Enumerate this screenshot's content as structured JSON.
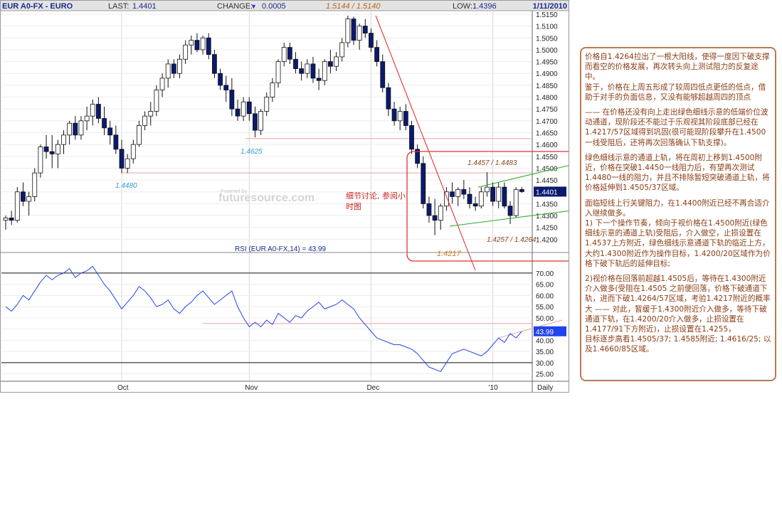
{
  "header": {
    "symbol": "EUR A0-FX - EURO",
    "last_label": "LAST:",
    "last_value": "1.4401",
    "high_low_text": "1.5144 / 1.5140",
    "change_label": "CHANGE:",
    "change_arrow": "▼",
    "change_value": "0.0005",
    "low_label": "LOW:",
    "low_value": "1.4396",
    "date": "1/11/2010"
  },
  "watermark": "futuresource.com",
  "watermark_small": "Powered by",
  "annotations": {
    "level_1_5144": "1.5144 / 1.5140",
    "level_1_4625": "1.4625",
    "level_1_4480": "1.4480",
    "level_1_4457": "1.4457 / 1.4483",
    "level_1_4257": "1.4257 / 1.4264",
    "level_1_4217": "1.4217",
    "note": "细节讨论, 参阅小\n时图"
  },
  "rsi": {
    "title": "RSI (EUR A0-FX,14) = 43.99",
    "value_label": "43.99"
  },
  "commentary": {
    "p1": "价格自1.4264拉出了一根大阳线，使得一度因下破支撑而看空的价格发展，再次转头向上测试阻力的反复途中。\n鉴于，价格在上周五形成了较周四低点更低的低点，借助于对手的负面信息，又没有能够超越周四的顶点",
    "p2": "—— 在价格还没有向上走出绿色细线示意的低端价位波动通道，现阶段还不能过于乐观视其阶段底部已经在1.4217/57区域得到巩固(很可能现阶段攀升在1.4500一线受阻后，还将再次回落确认下轨支撑)。",
    "p3": "绿色细线示意的通道上轨，将在周初上移到1.4500附近，价格在突破1.4450一线阻力后，有望再次测试1.4480一线的阻力，并且不排除暂短突破通道上轨，将价格延伸到1.4505/37区域。",
    "p4": "面临短线上行关键阻力，在1.4400附近已经不再合适介入继续做多。\n1) 下一个操作节奏，倾向于视价格在1.4500附近(绿色细线示意的通道上轨)受阻后，介入做空，止损设置在1.4537上方附近，绿色细线示意通道下轨的临近上方，大约1.4300附近作为操作目标，1.4200/20区域作为价格下破下轨后的延伸目标;",
    "p5": "2)视价格在回落前超越1.4505后，等待在1.4300附近介入做多(受阻在1.4505 之前便回落，价格下破通道下轨，进而下破1.4264/57区域，考验1.4217附近的概率大 —— 对此，暂缓于1.4300附近介入做多，等待下破通道下轨，在1.4200/20介入做多，止损设置在1.4177/91下方附近)，止损设置在1.4255，\n目标逐步高看1.4505/37; 1.4585附近; 1.4616/25; 以及1.4660/85区域。"
  },
  "colors": {
    "up_candle": "#ffffff",
    "down_candle": "#0a1a6e",
    "trend_red": "#dd2222",
    "channel_green": "#22aa22",
    "rsi_line": "#2244ee",
    "accent_box": "#dd3333",
    "commentary_text": "#8a3c14"
  },
  "chart_data": {
    "type": "candlestick",
    "price_axis": {
      "ylim": [
        1.4165,
        1.5165
      ],
      "ticks": [
        "1.5150",
        "1.5100",
        "1.5050",
        "1.5000",
        "1.4950",
        "1.4900",
        "1.4850",
        "1.4800",
        "1.4750",
        "1.4700",
        "1.4650",
        "1.4600",
        "1.4550",
        "1.4500",
        "1.4450",
        "1.4400",
        "1.4350",
        "1.4300",
        "1.4250",
        "1.4200"
      ]
    },
    "time_axis": {
      "labels": [
        "Oct",
        "Nov",
        "Dec",
        "'10",
        "Daily"
      ]
    },
    "rsi_axis": {
      "ylim": [
        22,
        76
      ],
      "ticks": [
        "70.00",
        "65.00",
        "60.00",
        "55.00",
        "50.00",
        "45.00",
        "40.00",
        "35.00",
        "30.00",
        "25.00"
      ],
      "overbought": 70,
      "oversold": 30
    },
    "ohlc": [
      [
        1.428,
        1.43,
        1.424,
        1.429
      ],
      [
        1.429,
        1.432,
        1.426,
        1.428
      ],
      [
        1.428,
        1.442,
        1.427,
        1.44
      ],
      [
        1.44,
        1.444,
        1.434,
        1.436
      ],
      [
        1.436,
        1.44,
        1.43,
        1.438
      ],
      [
        1.438,
        1.45,
        1.436,
        1.448
      ],
      [
        1.448,
        1.46,
        1.446,
        1.459
      ],
      [
        1.459,
        1.464,
        1.454,
        1.457
      ],
      [
        1.457,
        1.464,
        1.45,
        1.456
      ],
      [
        1.456,
        1.462,
        1.45,
        1.46
      ],
      [
        1.46,
        1.466,
        1.456,
        1.464
      ],
      [
        1.464,
        1.47,
        1.46,
        1.469
      ],
      [
        1.469,
        1.472,
        1.462,
        1.464
      ],
      [
        1.464,
        1.472,
        1.462,
        1.47
      ],
      [
        1.47,
        1.476,
        1.466,
        1.472
      ],
      [
        1.472,
        1.479,
        1.468,
        1.477
      ],
      [
        1.477,
        1.48,
        1.469,
        1.471
      ],
      [
        1.471,
        1.476,
        1.464,
        1.467
      ],
      [
        1.467,
        1.47,
        1.46,
        1.464
      ],
      [
        1.464,
        1.468,
        1.456,
        1.458
      ],
      [
        1.458,
        1.462,
        1.448,
        1.45
      ],
      [
        1.45,
        1.456,
        1.448,
        1.454
      ],
      [
        1.454,
        1.462,
        1.452,
        1.46
      ],
      [
        1.46,
        1.47,
        1.459,
        1.468
      ],
      [
        1.468,
        1.474,
        1.466,
        1.472
      ],
      [
        1.472,
        1.478,
        1.468,
        1.474
      ],
      [
        1.474,
        1.485,
        1.472,
        1.483
      ],
      [
        1.483,
        1.49,
        1.48,
        1.488
      ],
      [
        1.488,
        1.496,
        1.484,
        1.494
      ],
      [
        1.494,
        1.496,
        1.488,
        1.49
      ],
      [
        1.49,
        1.498,
        1.488,
        1.496
      ],
      [
        1.496,
        1.504,
        1.494,
        1.502
      ],
      [
        1.502,
        1.506,
        1.498,
        1.504
      ],
      [
        1.504,
        1.507,
        1.499,
        1.5
      ],
      [
        1.5,
        1.506,
        1.498,
        1.505
      ],
      [
        1.505,
        1.507,
        1.496,
        1.498
      ],
      [
        1.498,
        1.5,
        1.488,
        1.49
      ],
      [
        1.49,
        1.492,
        1.483,
        1.485
      ],
      [
        1.485,
        1.489,
        1.478,
        1.483
      ],
      [
        1.483,
        1.488,
        1.472,
        1.475
      ],
      [
        1.475,
        1.479,
        1.47,
        1.472
      ],
      [
        1.472,
        1.48,
        1.47,
        1.478
      ],
      [
        1.478,
        1.48,
        1.47,
        1.473
      ],
      [
        1.473,
        1.476,
        1.463,
        1.466
      ],
      [
        1.466,
        1.475,
        1.464,
        1.474
      ],
      [
        1.474,
        1.482,
        1.472,
        1.48
      ],
      [
        1.48,
        1.488,
        1.478,
        1.486
      ],
      [
        1.486,
        1.496,
        1.484,
        1.495
      ],
      [
        1.495,
        1.503,
        1.493,
        1.501
      ],
      [
        1.501,
        1.503,
        1.494,
        1.496
      ],
      [
        1.496,
        1.499,
        1.49,
        1.492
      ],
      [
        1.492,
        1.495,
        1.487,
        1.49
      ],
      [
        1.49,
        1.496,
        1.488,
        1.494
      ],
      [
        1.494,
        1.497,
        1.486,
        1.488
      ],
      [
        1.488,
        1.492,
        1.483,
        1.487
      ],
      [
        1.487,
        1.496,
        1.485,
        1.495
      ],
      [
        1.495,
        1.5,
        1.49,
        1.493
      ],
      [
        1.493,
        1.499,
        1.491,
        1.497
      ],
      [
        1.497,
        1.505,
        1.495,
        1.503
      ],
      [
        1.503,
        1.5144,
        1.501,
        1.513
      ],
      [
        1.513,
        1.514,
        1.502,
        1.504
      ],
      [
        1.504,
        1.511,
        1.5,
        1.51
      ],
      [
        1.51,
        1.513,
        1.505,
        1.507
      ],
      [
        1.507,
        1.509,
        1.499,
        1.501
      ],
      [
        1.501,
        1.504,
        1.493,
        1.495
      ],
      [
        1.495,
        1.498,
        1.482,
        1.484
      ],
      [
        1.484,
        1.486,
        1.472,
        1.475
      ],
      [
        1.475,
        1.478,
        1.468,
        1.47
      ],
      [
        1.47,
        1.476,
        1.466,
        1.474
      ],
      [
        1.474,
        1.477,
        1.466,
        1.468
      ],
      [
        1.468,
        1.47,
        1.456,
        1.458
      ],
      [
        1.458,
        1.46,
        1.45,
        1.452
      ],
      [
        1.452,
        1.455,
        1.433,
        1.435
      ],
      [
        1.435,
        1.438,
        1.427,
        1.43
      ],
      [
        1.43,
        1.437,
        1.4217,
        1.428
      ],
      [
        1.428,
        1.435,
        1.424,
        1.434
      ],
      [
        1.434,
        1.442,
        1.432,
        1.44
      ],
      [
        1.44,
        1.444,
        1.435,
        1.438
      ],
      [
        1.438,
        1.442,
        1.434,
        1.441
      ],
      [
        1.441,
        1.445,
        1.437,
        1.439
      ],
      [
        1.439,
        1.442,
        1.433,
        1.435
      ],
      [
        1.435,
        1.438,
        1.432,
        1.434
      ],
      [
        1.434,
        1.442,
        1.433,
        1.44
      ],
      [
        1.44,
        1.4483,
        1.438,
        1.442
      ],
      [
        1.442,
        1.444,
        1.434,
        1.436
      ],
      [
        1.436,
        1.444,
        1.433,
        1.442
      ],
      [
        1.442,
        1.444,
        1.433,
        1.434
      ],
      [
        1.434,
        1.436,
        1.4264,
        1.43
      ],
      [
        1.43,
        1.442,
        1.429,
        1.441
      ],
      [
        1.441,
        1.442,
        1.4396,
        1.4401
      ]
    ],
    "rsi_values": [
      55,
      53,
      56,
      60,
      58,
      62,
      66,
      69,
      67,
      69,
      70,
      72,
      68,
      70,
      71,
      73,
      69,
      65,
      62,
      58,
      54,
      57,
      60,
      64,
      62,
      59,
      55,
      56,
      58,
      54,
      52,
      55,
      57,
      60,
      62,
      59,
      56,
      58,
      60,
      62,
      55,
      50,
      46,
      48,
      46,
      49,
      47,
      52,
      50,
      48,
      51,
      50,
      53,
      55,
      57,
      54,
      55,
      56,
      58,
      56,
      54,
      50,
      47,
      44,
      41,
      40,
      39,
      38,
      38,
      37,
      36,
      34,
      31,
      28,
      27,
      26,
      30,
      34,
      35,
      36,
      35,
      34,
      33,
      35,
      38,
      41,
      39,
      43,
      41,
      44
    ]
  }
}
